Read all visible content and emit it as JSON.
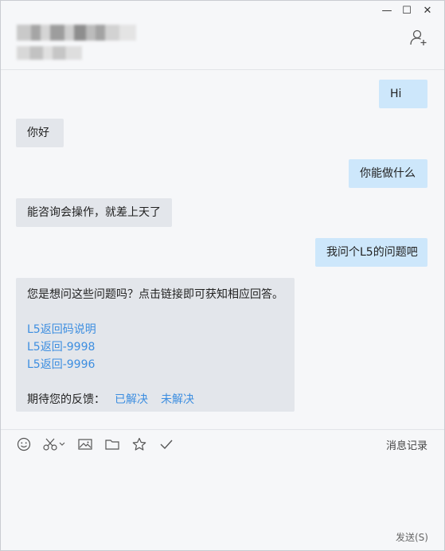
{
  "window_controls": {
    "minimize": "—",
    "maximize": "☐",
    "close": "✕"
  },
  "header": {
    "add_user_icon": "add-user-icon"
  },
  "messages": [
    {
      "from": "me",
      "text": "Hi"
    },
    {
      "from": "bot",
      "text": "你好"
    },
    {
      "from": "me",
      "text": "你能做什么"
    },
    {
      "from": "bot",
      "text": "能咨询会操作，就差上天了"
    },
    {
      "from": "me",
      "text": "我问个L5的问题吧"
    }
  ],
  "suggestion": {
    "intro": "您是想问这些问题吗？点击链接即可获知相应回答。",
    "links": [
      "L5返回码说明",
      "L5返回-9998",
      "L5返回-9996"
    ],
    "feedback_label": "期待您的反馈：",
    "resolved": "已解决",
    "unresolved": "未解决"
  },
  "toolbar": {
    "icons": [
      "emoji-icon",
      "screenshot-scissors-icon",
      "image-icon",
      "folder-icon",
      "star-icon",
      "check-icon"
    ],
    "history_label": "消息记录"
  },
  "composer": {
    "value": "",
    "send_label": "发送(S)"
  },
  "colors": {
    "my_bubble": "#cde7fb",
    "bot_bubble": "#e3e6eb",
    "link": "#3d8ee0",
    "background": "#f6f7f9"
  }
}
